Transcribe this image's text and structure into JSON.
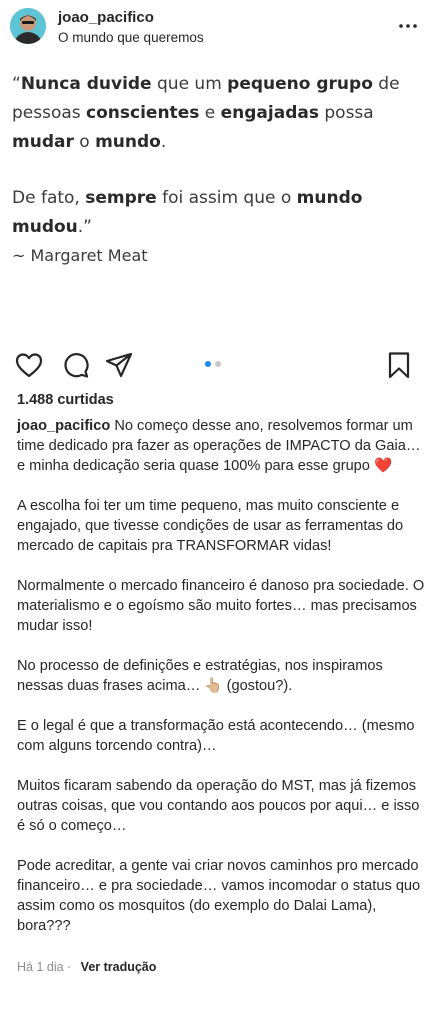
{
  "post": {
    "username": "joao_pacifico",
    "subtitle": "O mundo que queremos"
  },
  "image_quote": {
    "line1_pre": "“",
    "line1_b1": "Nunca duvide",
    "line1_t1": " que um ",
    "line1_b2": "pequeno grupo",
    "line1_t2": " de pessoas ",
    "line1_b3": "conscientes",
    "line1_t3": " e ",
    "line1_b4": "engajadas",
    "line1_t4": " possa ",
    "line1_b5": "mudar",
    "line1_t5": " o ",
    "line1_b6": "mundo",
    "line1_t6": ".",
    "line2_t1": "De fato, ",
    "line2_b1": "sempre",
    "line2_t2": " foi assim que o ",
    "line2_b2": "mundo mudou",
    "line2_t3": ".”",
    "author": "~ Margaret Meat"
  },
  "icons": {
    "heart": "heart-icon",
    "comment": "comment-icon",
    "share": "share-icon",
    "bookmark": "bookmark-icon",
    "more": "more-icon"
  },
  "carousel": {
    "count": 2,
    "active": 1,
    "active_color": "#1a8cff",
    "inactive_color": "#c8c8c8"
  },
  "likes": "1.488 curtidas",
  "caption": {
    "username": "joao_pacifico",
    "p1": " No começo desse ano, resolvemos formar um time dedicado pra fazer as operações de IMPACTO da Gaia… e minha dedicação seria quase 100% para esse grupo ❤️",
    "p2": "A escolha foi ter um time pequeno, mas muito consciente e engajado, que tivesse condições de usar as ferramentas do mercado de capitais pra TRANSFORMAR vidas!",
    "p3": "Normalmente o mercado financeiro é danoso pra sociedade.  O materialismo e o egoísmo são muito fortes… mas precisamos mudar isso!",
    "p4": "No processo de definições e estratégias, nos inspiramos nessas duas frases acima… 👆🏼 (gostou?).",
    "p5": "E o legal é que a transformação está acontecendo… (mesmo com alguns torcendo contra)…",
    "p6": "Muitos ficaram sabendo da operação do MST, mas já fizemos outras coisas, que vou contando aos poucos por aqui… e isso é só o começo…",
    "p7": "Pode acreditar, a gente vai criar novos caminhos pro mercado financeiro… e pra sociedade… vamos incomodar o status quo assim como os mosquitos (do exemplo do Dalai Lama), bora???"
  },
  "footer": {
    "time": "Há 1 dia",
    "separator": " · ",
    "translate": "Ver tradução"
  }
}
